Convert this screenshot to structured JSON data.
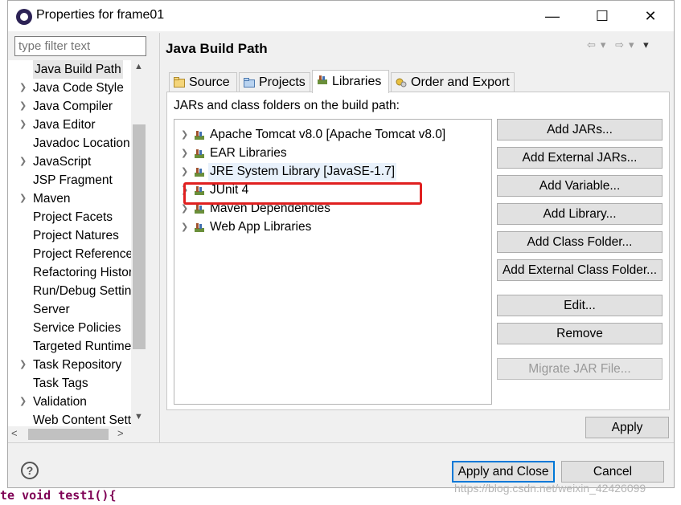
{
  "window": {
    "title": "Properties for frame01",
    "minimize_label": "—",
    "maximize_label": "☐",
    "close_label": "✕"
  },
  "filter": {
    "placeholder": "type filter text"
  },
  "tree": {
    "items": [
      {
        "label": "Java Build Path",
        "expandable": false,
        "selected": true
      },
      {
        "label": "Java Code Style",
        "expandable": true
      },
      {
        "label": "Java Compiler",
        "expandable": true
      },
      {
        "label": "Java Editor",
        "expandable": true
      },
      {
        "label": "Javadoc Location",
        "expandable": false
      },
      {
        "label": "JavaScript",
        "expandable": true
      },
      {
        "label": "JSP Fragment",
        "expandable": false
      },
      {
        "label": "Maven",
        "expandable": true
      },
      {
        "label": "Project Facets",
        "expandable": false
      },
      {
        "label": "Project Natures",
        "expandable": false
      },
      {
        "label": "Project References",
        "expandable": false
      },
      {
        "label": "Refactoring History",
        "expandable": false
      },
      {
        "label": "Run/Debug Settings",
        "expandable": false
      },
      {
        "label": "Server",
        "expandable": false
      },
      {
        "label": "Service Policies",
        "expandable": false
      },
      {
        "label": "Targeted Runtimes",
        "expandable": false
      },
      {
        "label": "Task Repository",
        "expandable": true
      },
      {
        "label": "Task Tags",
        "expandable": false
      },
      {
        "label": "Validation",
        "expandable": true
      },
      {
        "label": "Web Content Settings",
        "expandable": false
      }
    ]
  },
  "page": {
    "title": "Java Build Path"
  },
  "tabs": [
    {
      "label": "Source",
      "icon": "source-folder-icon"
    },
    {
      "label": "Projects",
      "icon": "projects-icon"
    },
    {
      "label": "Libraries",
      "icon": "libraries-icon",
      "active": true
    },
    {
      "label": "Order and Export",
      "icon": "order-export-icon"
    }
  ],
  "libraries": {
    "description": "JARs and class folders on the build path:",
    "items": [
      {
        "label": "Apache Tomcat v8.0 [Apache Tomcat v8.0]"
      },
      {
        "label": "EAR Libraries"
      },
      {
        "label": "JRE System Library [JavaSE-1.7]",
        "highlighted": true
      },
      {
        "label": "JUnit 4"
      },
      {
        "label": "Maven Dependencies"
      },
      {
        "label": "Web App Libraries"
      }
    ]
  },
  "buttons": {
    "add_jars": "Add JARs...",
    "add_external_jars": "Add External JARs...",
    "add_variable": "Add Variable...",
    "add_library": "Add Library...",
    "add_class_folder": "Add Class Folder...",
    "add_external_class_folder": "Add External Class Folder...",
    "edit": "Edit...",
    "remove": "Remove",
    "migrate_jar": "Migrate JAR File...",
    "apply": "Apply",
    "apply_and_close": "Apply and Close",
    "cancel": "Cancel"
  },
  "footer": {
    "help_label": "?",
    "watermark": "https://blog.csdn.net/weixin_42426099"
  },
  "background_text": {
    "bottom_code": "te void test1(){"
  },
  "colors": {
    "annotation_box": "#e02020",
    "primary_button_border": "#0078d7",
    "tree_selection": "#e5e5e5"
  }
}
